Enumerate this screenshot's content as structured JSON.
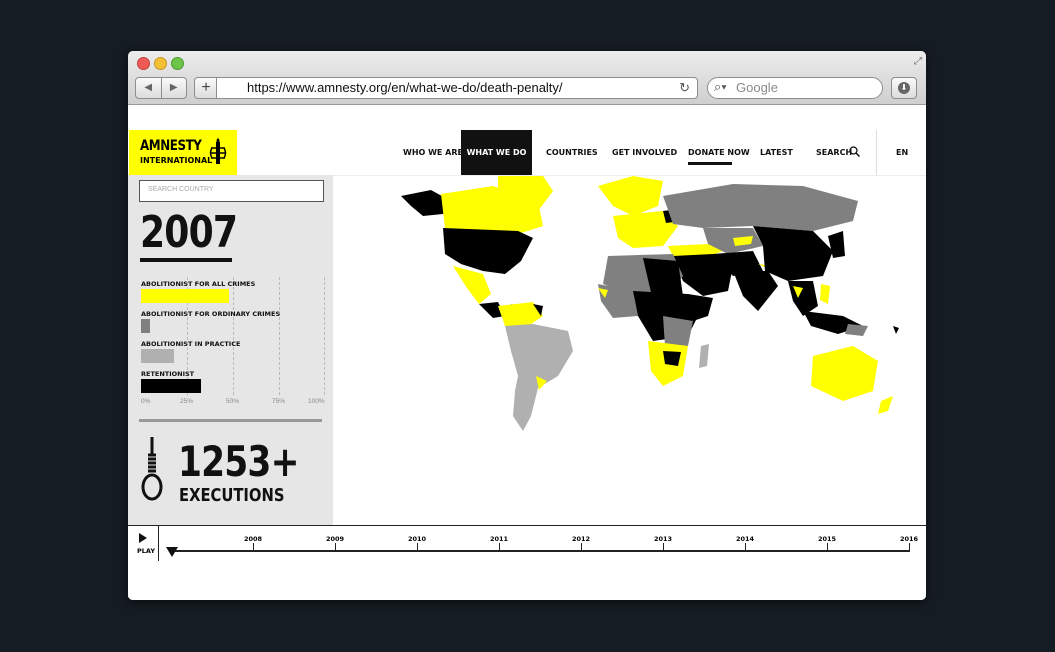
{
  "browser": {
    "url": "https://www.amnesty.org/en/what-we-do/death-penalty/",
    "search_placeholder": "Google",
    "add_tab": "+",
    "back": "◀",
    "forward": "▶"
  },
  "site": {
    "logo_line1": "AMNESTY",
    "logo_line2": "INTERNATIONAL",
    "nav": [
      "WHO WE ARE",
      "WHAT WE DO",
      "COUNTRIES",
      "GET INVOLVED",
      "DONATE NOW",
      "LATEST",
      "SEARCH"
    ],
    "active_nav": "WHAT WE DO",
    "language": "EN"
  },
  "sidebar": {
    "search_placeholder": "SEARCH COUNTRY",
    "year": "2007",
    "categories": [
      {
        "label": "ABOLITIONIST FOR ALL CRIMES",
        "color": "#ffff00",
        "share_pct": 48
      },
      {
        "label": "ABOLITIONIST FOR ORDINARY CRIMES",
        "color": "#808080",
        "share_pct": 5
      },
      {
        "label": "ABOLITIONIST IN PRACTICE",
        "color": "#b0b0b0",
        "share_pct": 18
      },
      {
        "label": "RETENTIONIST",
        "color": "#000000",
        "share_pct": 33
      }
    ],
    "scale": [
      "0%",
      "25%",
      "50%",
      "75%",
      "100%"
    ],
    "executions_count": "1253+",
    "executions_label": "EXECUTIONS"
  },
  "map": {
    "zoom_in": "+",
    "zoom_out": "-"
  },
  "timeline": {
    "play_label": "PLAY",
    "years": [
      "2008",
      "2009",
      "2010",
      "2011",
      "2012",
      "2013",
      "2014",
      "2015",
      "2016"
    ],
    "current_year": "2007"
  },
  "colors": {
    "accent": "#ffff00",
    "retentionist": "#000000",
    "ordinary": "#808080",
    "practice": "#b0b0b0"
  }
}
